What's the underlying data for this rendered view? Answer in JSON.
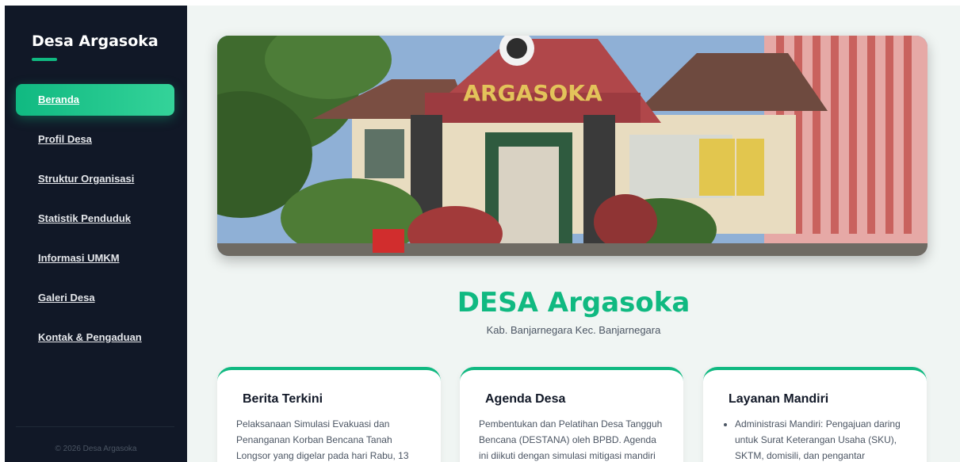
{
  "sidebar": {
    "brand": "Desa Argasoka",
    "items": [
      {
        "label": "Beranda",
        "active": true
      },
      {
        "label": "Profil Desa"
      },
      {
        "label": "Struktur Organisasi"
      },
      {
        "label": "Statistik Penduduk"
      },
      {
        "label": "Informasi UMKM"
      },
      {
        "label": "Galeri Desa"
      },
      {
        "label": "Kontak & Pengaduan"
      }
    ],
    "footer": "© 2026 Desa Argasoka"
  },
  "hero": {
    "sign_text": "ARGASOKA"
  },
  "main": {
    "title": "DESA Argasoka",
    "subtitle": "Kab. Banjarnegara Kec. Banjarnegara"
  },
  "cards": [
    {
      "title": "Berita Terkini",
      "text": "Pelaksanaan Simulasi Evakuasi dan Penanganan Korban Bencana Tanah Longsor yang digelar pada hari Rabu, 13"
    },
    {
      "title": "Agenda Desa",
      "text": "Pembentukan dan Pelatihan Desa Tangguh Bencana (DESTANA) oleh BPBD. Agenda ini diikuti dengan simulasi mitigasi mandiri"
    },
    {
      "title": "Layanan Mandiri",
      "items": [
        "Administrasi Mandiri: Pengajuan daring untuk Surat Keterangan Usaha (SKU), SKTM, domisili, dan pengantar"
      ]
    }
  ],
  "colors": {
    "accent": "#10b981",
    "sidebar_bg": "#111827",
    "main_bg": "#f0f5f3"
  }
}
